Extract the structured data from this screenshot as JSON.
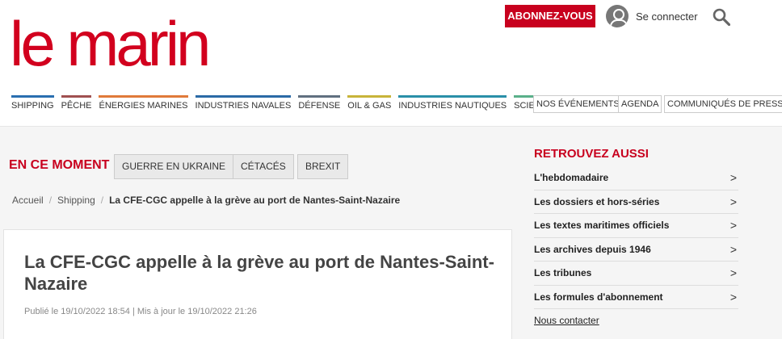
{
  "logo": {
    "text": "le marin"
  },
  "header": {
    "subscribe_label": "ABONNEZ-VOUS",
    "login_label": "Se connecter"
  },
  "nav": {
    "items": [
      {
        "label": "SHIPPING",
        "color": "#2a6fb0"
      },
      {
        "label": "PÊCHE",
        "color": "#a05050"
      },
      {
        "label": "ÉNERGIES MARINES",
        "color": "#e07a3a"
      },
      {
        "label": "INDUSTRIES NAVALES",
        "color": "#2b6aa6"
      },
      {
        "label": "DÉFENSE",
        "color": "#607080"
      },
      {
        "label": "OIL & GAS",
        "color": "#c8b43a"
      },
      {
        "label": "INDUSTRIES NAUTIQUES",
        "color": "#2a8fa8"
      },
      {
        "label": "SCIENCES",
        "color": "#5ab08a"
      }
    ],
    "right_links": [
      "NOS ÉVÉNEMENTS",
      "AGENDA",
      "COMMUNIQUÉS DE PRESSE"
    ]
  },
  "moment": {
    "label": "EN CE MOMENT",
    "tags": [
      "GUERRE EN UKRAINE",
      "CÉTACÉS",
      "BREXIT"
    ]
  },
  "breadcrumb": {
    "items": [
      "Accueil",
      "Shipping",
      "La CFE-CGC appelle à la grève au port de Nantes-Saint-Nazaire"
    ]
  },
  "article": {
    "title": "La CFE-CGC appelle à la grève au port de Nantes-Saint-Nazaire",
    "meta": "Publié le 19/10/2022 18:54 | Mis à jour le 19/10/2022 21:26"
  },
  "sidebar": {
    "title": "RETROUVEZ AUSSI",
    "items": [
      "L'hebdomadaire",
      "Les dossiers et hors-séries",
      "Les textes maritimes officiels",
      "Les archives depuis 1946",
      "Les tribunes",
      "Les formules d'abonnement"
    ],
    "contact": "Nous contacter"
  },
  "colors": {
    "accent": "#c8001e"
  }
}
